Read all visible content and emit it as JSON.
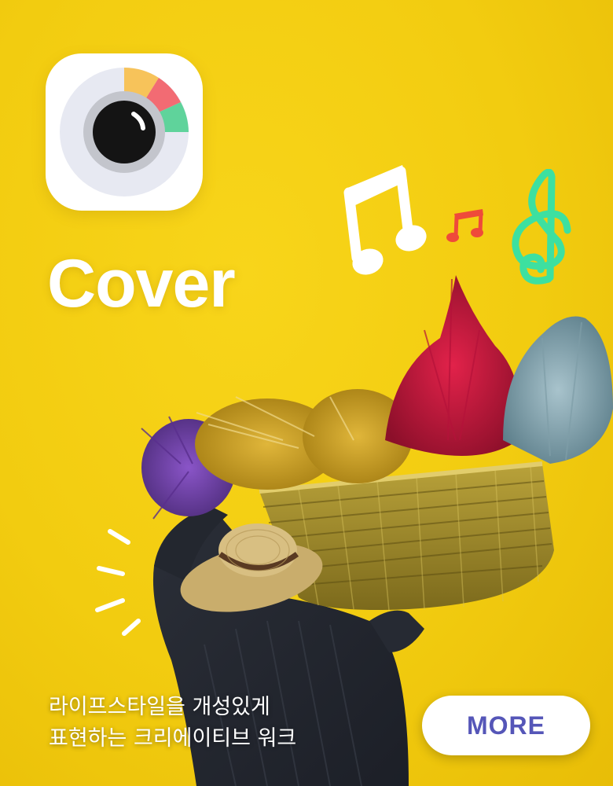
{
  "app": {
    "name": "Cover",
    "icon": "camera-lens-icon"
  },
  "tagline": {
    "line1": "라이프스타일을 개성있게",
    "line2": "표현하는 크리에이티브 워크"
  },
  "cta": {
    "label": "MORE"
  },
  "decorations": {
    "icons": [
      "beamed-note-icon",
      "small-note-icon",
      "treble-clef-icon",
      "burst-lines-icon"
    ]
  },
  "colors": {
    "background": "#f2cc10",
    "button_text": "#5556b8",
    "arc_yellow": "#f7c35a",
    "arc_coral": "#f26b73",
    "arc_green": "#5fd39b",
    "treble_clef": "#3de0a0",
    "small_note": "#ef4a3a"
  }
}
